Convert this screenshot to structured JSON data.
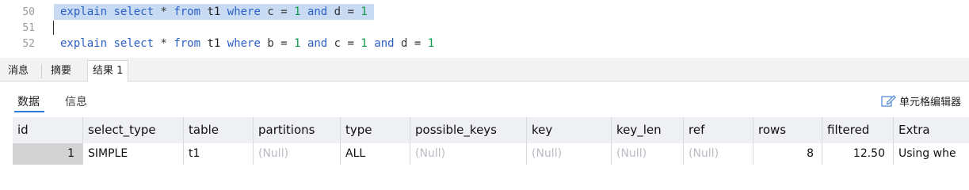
{
  "editor": {
    "line_numbers": [
      "50",
      "51",
      "52"
    ],
    "line50": {
      "tokens": [
        {
          "t": "explain",
          "c": "kw"
        },
        {
          "t": " ",
          "c": "op"
        },
        {
          "t": "select",
          "c": "kw"
        },
        {
          "t": " * ",
          "c": "op"
        },
        {
          "t": "from",
          "c": "kw"
        },
        {
          "t": " t1 ",
          "c": "ident"
        },
        {
          "t": "where",
          "c": "kw"
        },
        {
          "t": " c = ",
          "c": "op"
        },
        {
          "t": "1",
          "c": "num"
        },
        {
          "t": " ",
          "c": "op"
        },
        {
          "t": "and",
          "c": "kw"
        },
        {
          "t": " d = ",
          "c": "op"
        },
        {
          "t": "1",
          "c": "num"
        }
      ]
    },
    "line52": {
      "tokens": [
        {
          "t": "explain",
          "c": "kw"
        },
        {
          "t": " ",
          "c": "op"
        },
        {
          "t": "select",
          "c": "kw"
        },
        {
          "t": " * ",
          "c": "op"
        },
        {
          "t": "from",
          "c": "kw"
        },
        {
          "t": " t1 ",
          "c": "ident"
        },
        {
          "t": "where",
          "c": "kw"
        },
        {
          "t": " b = ",
          "c": "op"
        },
        {
          "t": "1",
          "c": "num"
        },
        {
          "t": " ",
          "c": "op"
        },
        {
          "t": "and",
          "c": "kw"
        },
        {
          "t": " c = ",
          "c": "op"
        },
        {
          "t": "1",
          "c": "num"
        },
        {
          "t": " ",
          "c": "op"
        },
        {
          "t": "and",
          "c": "kw"
        },
        {
          "t": " d = ",
          "c": "op"
        },
        {
          "t": "1",
          "c": "num"
        }
      ]
    }
  },
  "tabs": {
    "messages": "消息",
    "summary": "摘要",
    "result1": "结果 1"
  },
  "subtabs": {
    "data": "数据",
    "info": "信息",
    "cell_editor": "单元格编辑器"
  },
  "grid": {
    "headers": [
      "id",
      "select_type",
      "table",
      "partitions",
      "type",
      "possible_keys",
      "key",
      "key_len",
      "ref",
      "rows",
      "filtered",
      "Extra"
    ],
    "row": {
      "id": "1",
      "select_type": "SIMPLE",
      "table": "t1",
      "partitions": "(Null)",
      "type": "ALL",
      "possible_keys": "(Null)",
      "key": "(Null)",
      "key_len": "(Null)",
      "ref": "(Null)",
      "rows": "8",
      "filtered": "12.50",
      "extra": "Using whe"
    }
  },
  "colors": {
    "keyword": "#2a5fc6",
    "number": "#0b9a4a",
    "selection": "#c8dbf3",
    "active_underline": "#2a7ae2",
    "null_text": "#b8bcc4"
  }
}
